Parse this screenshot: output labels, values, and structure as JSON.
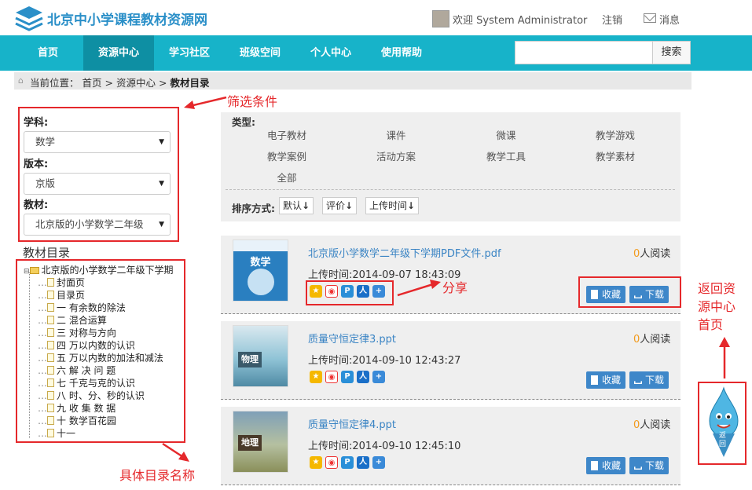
{
  "header": {
    "site_title": "北京中小学课程教材资源网",
    "welcome": "欢迎 System Administrator",
    "logout": "注销",
    "messages": "消息"
  },
  "nav": {
    "items": [
      "首页",
      "资源中心",
      "学习社区",
      "班级空间",
      "个人中心",
      "使用帮助"
    ],
    "active": "资源中心",
    "search_button": "搜索",
    "search_value": ""
  },
  "breadcrumb": {
    "prefix": "当前位置：",
    "home": "首页",
    "sep": ">",
    "center": "资源中心",
    "current": "教材目录"
  },
  "filters": {
    "subject_label": "学科:",
    "subject_value": "数学",
    "edition_label": "版本:",
    "edition_value": "京版",
    "textbook_label": "教材:",
    "textbook_value": "北京版的小学数学二年级"
  },
  "toc": {
    "title": "教材目录",
    "root": "北京版的小学数学二年级下学期",
    "items": [
      "封面页",
      "目录页",
      "一 有余数的除法",
      "二 混合运算",
      "三 对称与方向",
      "四 万以内数的认识",
      "五 万以内数的加法和减法",
      "六 解 决 问 题",
      "七 千克与克的认识",
      "八 时、分、秒的认识",
      "九 收 集 数 据",
      "十 数学百花园",
      "十一"
    ]
  },
  "types": {
    "title": "类型:",
    "items": [
      "电子教材",
      "课件",
      "微课",
      "教学游戏",
      "教学案例",
      "活动方案",
      "教学工具",
      "教学素材",
      "全部"
    ]
  },
  "sort": {
    "label": "排序方式:",
    "options": [
      "默认",
      "评价",
      "上传时间"
    ],
    "arrow": "↓"
  },
  "resources": [
    {
      "title": "北京版小学数学二年级下学期PDF文件.pdf",
      "time": "上传时间:2014-09-07 18:43:09",
      "reads_count": "0",
      "reads_suffix": "人阅读",
      "cover_text": "数学",
      "cover_color": "#1f86c7"
    },
    {
      "title": "质量守恒定律3.ppt",
      "time": "上传时间:2014-09-10 12:43:27",
      "reads_count": "0",
      "reads_suffix": "人阅读",
      "cover_text": "物理",
      "cover_color": "#5a9fb8"
    },
    {
      "title": "质量守恒定律4.ppt",
      "time": "上传时间:2014-09-10 12:45:10",
      "reads_count": "0",
      "reads_suffix": "人阅读",
      "cover_text": "地理",
      "cover_color": "#8a8f5a"
    }
  ],
  "buttons": {
    "favorite": "收藏",
    "download": "下载"
  },
  "share_icons": [
    "qzone-icon",
    "weibo-icon",
    "pengyou-icon",
    "renren-icon",
    "more-share-icon"
  ],
  "annotations": {
    "filter": "筛选条件",
    "share": "分享",
    "toc_names": "具体目录名称",
    "back_home": [
      "返回资",
      "源中心",
      "首页"
    ]
  },
  "mascot_label": [
    "返",
    "回"
  ],
  "colors": {
    "nav": "#17b3c9",
    "nav_active": "#0e8fa3",
    "link": "#3a84c4",
    "button": "#3e87c9",
    "annotation": "#e5282b"
  }
}
